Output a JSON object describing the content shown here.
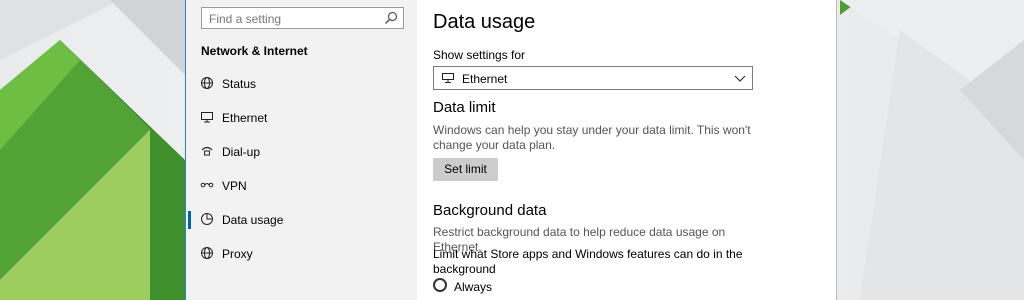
{
  "search": {
    "placeholder": "Find a setting"
  },
  "sidebar": {
    "section_title": "Network & Internet",
    "items": [
      {
        "label": "Status",
        "icon": "globe-status-icon"
      },
      {
        "label": "Ethernet",
        "icon": "ethernet-icon"
      },
      {
        "label": "Dial-up",
        "icon": "dialup-icon"
      },
      {
        "label": "VPN",
        "icon": "vpn-icon"
      },
      {
        "label": "Data usage",
        "icon": "data-usage-icon",
        "selected": true
      },
      {
        "label": "Proxy",
        "icon": "globe-icon"
      }
    ]
  },
  "main": {
    "title": "Data usage",
    "show_settings_label": "Show settings for",
    "network_select": {
      "value": "Ethernet",
      "icon": "ethernet-icon"
    },
    "data_limit": {
      "heading": "Data limit",
      "description_line1": "Windows can help you stay under your data limit. This won't",
      "description_line2": "change your data plan.",
      "button_label": "Set limit"
    },
    "background_data": {
      "heading": "Background data",
      "description": "Restrict background data to help reduce data usage on Ethernet.",
      "limit_label_line1": "Limit what Store apps and Windows features can do in the",
      "limit_label_line2": "background",
      "option_always": "Always"
    }
  },
  "colors": {
    "accent": "#0063b1",
    "sidebar_bg": "#f2f2f2",
    "window_border": "#2b7fd4"
  }
}
